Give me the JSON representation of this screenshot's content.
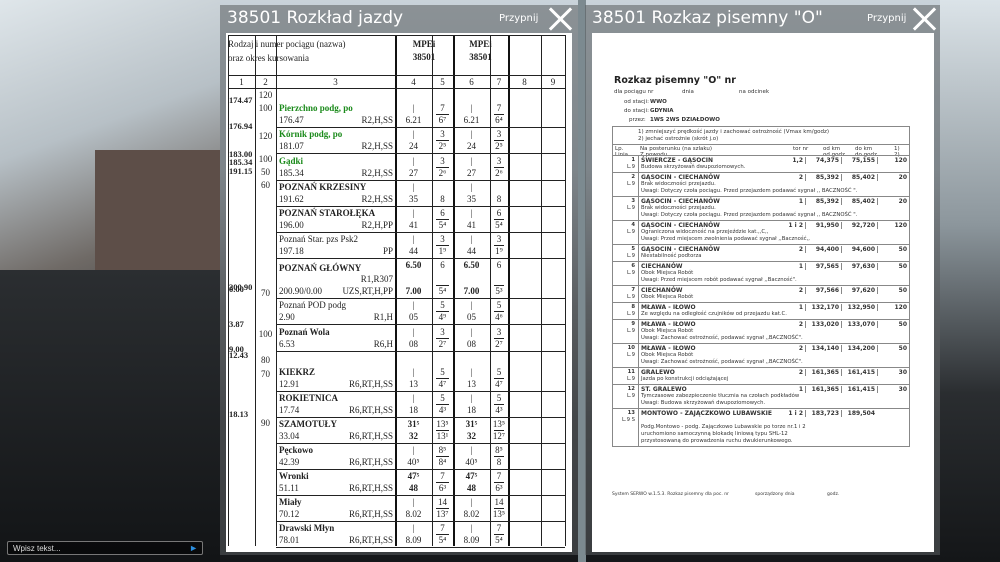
{
  "left_window": {
    "title": "38501 Rozkład jazdy",
    "pin": "Przypnij",
    "header": {
      "desc1": "Rodzaj i numer pociągu (nazwa)",
      "desc2": "oraz okres kursowania",
      "train_type": "MPEi",
      "train_no": "38501",
      "cols": [
        "1",
        "2",
        "3",
        "4",
        "5",
        "6",
        "7",
        "8",
        "9"
      ]
    },
    "km_col": [
      "174.47",
      "176.94",
      "183.00",
      "185.34",
      "191.15",
      "200.90",
      "0.00",
      "3.87",
      "9.00",
      "12.43",
      "18.13"
    ],
    "speed_col": [
      "120",
      "100",
      "120",
      "100",
      "50",
      "60",
      "70",
      "100",
      "80",
      "70",
      "90"
    ],
    "rows": [
      {
        "name": "Pierzchno podg, po",
        "style": "g",
        "km": "176.47",
        "codes": "R2,H,SS",
        "c4": [
          "|",
          "6.21"
        ],
        "c5": [
          "7",
          "6⁷"
        ],
        "c6": [
          "|",
          "6.21"
        ],
        "c7": [
          "7",
          "6⁴"
        ]
      },
      {
        "name": "Kórnik podg, po",
        "style": "g",
        "km": "181.07",
        "codes": "R2,H,SS",
        "c4": [
          "|",
          "24"
        ],
        "c5": [
          "3",
          "2⁵"
        ],
        "c6": [
          "|",
          "24"
        ],
        "c7": [
          "3",
          "2⁵"
        ]
      },
      {
        "name": "Gądki",
        "style": "g",
        "km": "185.34",
        "codes": "R2,H,SS",
        "c4": [
          "|",
          "27"
        ],
        "c5": [
          "3",
          "2⁶"
        ],
        "c6": [
          "|",
          "27"
        ],
        "c7": [
          "3",
          "2⁶"
        ]
      },
      {
        "name": "POZNAŃ KRZESINY",
        "style": "bd",
        "km": "191.62",
        "codes": "R2,H,SS",
        "c4": [
          "|",
          "35"
        ],
        "c5": [
          "",
          "8"
        ],
        "c6": [
          "|",
          "35"
        ],
        "c7": [
          "",
          "8"
        ]
      },
      {
        "name": "POZNAŃ STAROŁĘKA",
        "style": "bd",
        "km": "196.00",
        "codes": "R2,H,PP",
        "c4": [
          "|",
          "41"
        ],
        "c5": [
          "6",
          "5⁴"
        ],
        "c6": [
          "|",
          "41"
        ],
        "c7": [
          "6",
          "5⁴"
        ]
      },
      {
        "name": "Poznań Star. pzs Psk2",
        "style": "",
        "km": "197.18",
        "codes": "PP",
        "c4": [
          "|",
          "44"
        ],
        "c5": [
          "3",
          "1⁹"
        ],
        "c6": [
          "|",
          "44"
        ],
        "c7": [
          "3",
          "1⁹"
        ]
      },
      {
        "name": "POZNAŃ GŁÓWNY",
        "style": "bd",
        "km": "200.90/0.00",
        "codes": "R1,R307",
        "codes2": "UZS,RT,H,PP",
        "c4": [
          "6.50",
          "7.00"
        ],
        "c5": [
          "6",
          "5⁴"
        ],
        "c6": [
          "6.50",
          "7.00"
        ],
        "c7": [
          "6",
          "5³"
        ]
      },
      {
        "name": "Poznań POD podg",
        "style": "",
        "km": "2.90",
        "codes": "R1,H",
        "c4": [
          "|",
          "05"
        ],
        "c5": [
          "5",
          "4⁹"
        ],
        "c6": [
          "|",
          "05"
        ],
        "c7": [
          "5",
          "4⁶"
        ]
      },
      {
        "name": "Poznań Wola",
        "style": "bd",
        "km": "6.53",
        "codes": "R6,H",
        "c4": [
          "|",
          "08"
        ],
        "c5": [
          "3",
          "2⁷"
        ],
        "c6": [
          "|",
          "08"
        ],
        "c7": [
          "3",
          "2⁷"
        ]
      },
      {
        "name": "KIEKRZ",
        "style": "bd",
        "km": "12.91",
        "codes": "R6,RT,H,SS",
        "c4": [
          "|",
          "13"
        ],
        "c5": [
          "5",
          "4⁷"
        ],
        "c6": [
          "|",
          "13"
        ],
        "c7": [
          "5",
          "4⁷"
        ]
      },
      {
        "name": "ROKIETNICA",
        "style": "bd",
        "km": "17.74",
        "codes": "R6,RT,H,SS",
        "c4": [
          "|",
          "18"
        ],
        "c5": [
          "5",
          "4³"
        ],
        "c6": [
          "|",
          "18"
        ],
        "c7": [
          "5",
          "4³"
        ]
      },
      {
        "name": "SZAMOTUŁY",
        "style": "bd",
        "km": "33.04",
        "codes": "R6,RT,H,SS",
        "c4": [
          "31⁵",
          "32"
        ],
        "c5": [
          "13⁵",
          "13¹"
        ],
        "c6": [
          "31⁵",
          "32"
        ],
        "c7": [
          "13⁵",
          "12⁷"
        ]
      },
      {
        "name": "Pęckowo",
        "style": "bd",
        "km": "42.39",
        "codes": "R6,RT,H,SS",
        "c4": [
          "|",
          "40⁵"
        ],
        "c5": [
          "8⁵",
          "8⁴"
        ],
        "c6": [
          "|",
          "40⁵"
        ],
        "c7": [
          "8⁵",
          "8"
        ]
      },
      {
        "name": "Wronki",
        "style": "bd",
        "km": "51.11",
        "codes": "R6,RT,H,SS",
        "c4": [
          "47⁵",
          "48"
        ],
        "c5": [
          "7",
          "6³"
        ],
        "c6": [
          "47⁵",
          "48"
        ],
        "c7": [
          "7",
          "6³"
        ]
      },
      {
        "name": "Miały",
        "style": "bd",
        "km": "70.12",
        "codes": "R6,RT,H,SS",
        "c4": [
          "|",
          "8.02"
        ],
        "c5": [
          "14",
          "13⁷"
        ],
        "c6": [
          "|",
          "8.02"
        ],
        "c7": [
          "14",
          "13⁵"
        ]
      },
      {
        "name": "Drawski Młyn",
        "style": "bd",
        "km": "78.01",
        "codes": "R6,RT,H,SS",
        "c4": [
          "|",
          "8.09"
        ],
        "c5": [
          "7",
          "5⁴"
        ],
        "c6": [
          "|",
          "8.09"
        ],
        "c7": [
          "7",
          "5⁴"
        ]
      }
    ]
  },
  "right_window": {
    "title": "38501 Rozkaz pisemny \"O\"",
    "pin": "Przypnij",
    "doc": {
      "heading": "Rozkaz pisemny \"O\" nr",
      "sub1": "dla pociągu nr",
      "sub2": "dnia",
      "sub3": "na odcinek",
      "from_label": "od stacji:",
      "from": "WWO",
      "to_label": "do stacji:",
      "to": "GDYNIA",
      "via_label": "przez:",
      "via": "1WS 2WS DZIAŁDOWO",
      "note1": "1) zmniejszyć prędkość jazdy i zachować ostrożność (Vmax km/godz)",
      "note2": "2) jechać ostrożnie (skrót j.o)",
      "th": {
        "lp": "Lp.",
        "linia": "Linia",
        "post": "Na posterunku (na szlaku)",
        "reason": "Z powodu",
        "track": "tor nr",
        "from_km": "od km",
        "from_h": "od godz.",
        "to_km": "do km",
        "to_h": "do godz.",
        "n1": "1)",
        "n2": "2)"
      },
      "rows": [
        {
          "lp": "1",
          "line": "L.9",
          "name": "ŚWIERCZE - GĄSOCIN",
          "track": "1,2",
          "from": "74,375",
          "to": "75,155",
          "v": "120",
          "lines": [
            "Budowa skrzyżowań dwupoziomowych."
          ]
        },
        {
          "lp": "2",
          "line": "L.9",
          "name": "GĄSOCIN - CIECHANÓW",
          "track": "2",
          "from": "85,392",
          "to": "85,402",
          "v": "20",
          "lines": [
            "Brak widoczności przejazdu.",
            "Uwagi: Dotyczy czoła pociągu. Przed przejazdem podawać sygnał ,, BACZNOŚĆ \"."
          ]
        },
        {
          "lp": "3",
          "line": "L.9",
          "name": "GĄSOCIN - CIECHANÓW",
          "track": "1",
          "from": "85,392",
          "to": "85,402",
          "v": "20",
          "lines": [
            "Brak widoczności przejazdu.",
            "Uwagi: Dotyczy czoła pociągu. Przed przejazdem podawać sygnał ,, BACZNOŚĆ \"."
          ]
        },
        {
          "lp": "4",
          "line": "L.9",
          "name": "GĄSOCIN - CIECHANÓW",
          "track": "1 i 2",
          "from": "91,950",
          "to": "92,720",
          "v": "120",
          "lines": [
            "Ograniczona widoczność na przejeździe kat.,,C,,",
            "Uwagi: Przed miejscem zwolnienia podawać sygnał ,,Baczność,,"
          ]
        },
        {
          "lp": "5",
          "line": "L.9",
          "name": "GĄSOCIN - CIECHANÓW",
          "track": "2",
          "from": "94,400",
          "to": "94,600",
          "v": "50",
          "lines": [
            "Niestabilność podtorza"
          ]
        },
        {
          "lp": "6",
          "line": "L.9",
          "name": "CIECHANÓW",
          "track": "1",
          "from": "97,565",
          "to": "97,630",
          "v": "50",
          "lines": [
            "Obok Miejsca Robót",
            "Uwagi: Przed miejscem robót podawać sygnał ,,Baczność\"."
          ]
        },
        {
          "lp": "7",
          "line": "L.9",
          "name": "CIECHANÓW",
          "track": "2",
          "from": "97,566",
          "to": "97,620",
          "v": "50",
          "lines": [
            "Obok Miejsca Robót"
          ]
        },
        {
          "lp": "8",
          "line": "L.9",
          "name": "MŁAWA - IŁOWO",
          "track": "1",
          "from": "132,170",
          "to": "132,950",
          "v": "120",
          "lines": [
            "Ze względu na odległość czujników od przejazdu kat.C."
          ]
        },
        {
          "lp": "9",
          "line": "L.9",
          "name": "MŁAWA - IŁOWO",
          "track": "2",
          "from": "133,020",
          "to": "133,070",
          "v": "50",
          "lines": [
            "Obok Miejsca Robót",
            "Uwagi: Zachować ostrożność, podawać sygnał ,,BACZNOŚĆ\"."
          ]
        },
        {
          "lp": "10",
          "line": "L.9",
          "name": "MŁAWA - IŁOWO",
          "track": "2",
          "from": "134,140",
          "to": "134,200",
          "v": "50",
          "lines": [
            "Obok Miejsca Robót",
            "Uwagi: Zachować ostrożność, podawać sygnał ,,BACZNOŚĆ\"."
          ]
        },
        {
          "lp": "11",
          "line": "L.9",
          "name": "GRALEWO",
          "track": "2",
          "from": "161,365",
          "to": "161,415",
          "v": "30",
          "lines": [
            "Jazda po konstrukcji odciążającej"
          ]
        },
        {
          "lp": "12",
          "line": "L.9",
          "name": "ST. GRALEWO",
          "track": "1",
          "from": "161,365",
          "to": "161,415",
          "v": "30",
          "lines": [
            "Tymczasowe zabezpieczenie tłucznia na czołach podkładów",
            "Uwagi: Budowa skrzyżowań dwupoziomowych."
          ]
        },
        {
          "lp": "13",
          "line": "L.9 S",
          "name": "MONTOWO - ZAJĄCZKOWO LUBAWSKIE",
          "track": "1 i 2",
          "from": "183,723",
          "to": "189,504",
          "v": "",
          "lines": [
            "",
            "Podg.Montowo - podg. Zajączkowo Lubawskie po torze nr.1 i 2",
            "uruchomiono samoczynną blokadę liniową typu SHL-12",
            "przystosowaną do prowadzenia ruchu dwukierunkowego."
          ]
        }
      ],
      "footer1": "System SERWO w.1.5.3. Rozkaz pisemny dla poc. nr",
      "footer2": "sporządzony dnia",
      "footer3": "godz."
    }
  },
  "chat": {
    "placeholder": "Wpisz tekst..."
  }
}
